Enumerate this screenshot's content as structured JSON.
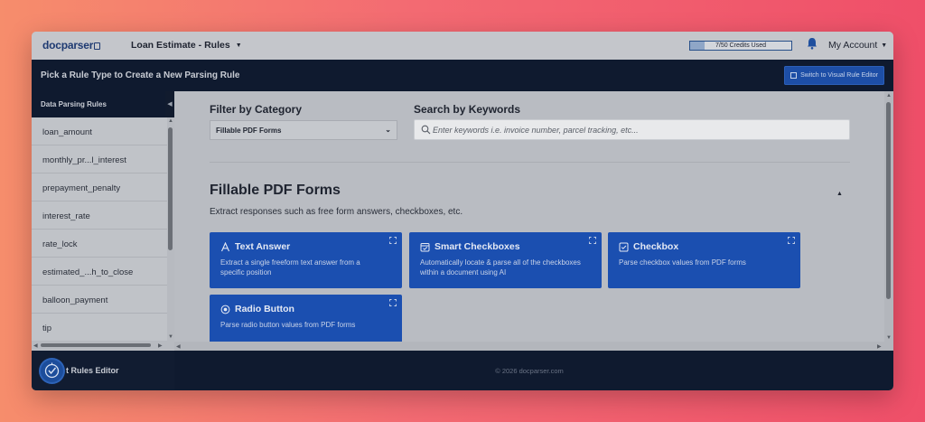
{
  "app": {
    "logo_text": "docparser",
    "document_title": "Loan Estimate - Rules",
    "credits": "7/50 Credits Used",
    "credits_fraction": 0.14,
    "account_label": "My Account"
  },
  "header": {
    "instruction": "Pick a Rule Type to Create a New Parsing Rule",
    "visual_editor_button": "Switch to Visual Rule Editor"
  },
  "sidebar": {
    "title": "Data Parsing Rules",
    "items": [
      {
        "label": "loan_amount"
      },
      {
        "label": "monthly_pr...l_interest"
      },
      {
        "label": "prepayment_penalty"
      },
      {
        "label": "interest_rate"
      },
      {
        "label": "rate_lock"
      },
      {
        "label": "estimated_...h_to_close"
      },
      {
        "label": "balloon_payment"
      },
      {
        "label": "tip"
      }
    ]
  },
  "filter": {
    "label": "Filter by Category",
    "selected": "Fillable PDF Forms"
  },
  "search": {
    "label": "Search by Keywords",
    "placeholder": "Enter keywords i.e. invoice number, parcel tracking, etc..."
  },
  "section": {
    "title": "Fillable PDF Forms",
    "description": "Extract responses such as free form answers, checkboxes, etc."
  },
  "cards": [
    {
      "title": "Text Answer",
      "description": "Extract a single freeform text answer from a specific position",
      "icon": "text-icon"
    },
    {
      "title": "Smart Checkboxes",
      "description": "Automatically locate & parse all of the checkboxes within a document using AI",
      "icon": "smart-checkbox-icon"
    },
    {
      "title": "Checkbox",
      "description": "Parse checkbox values from PDF forms",
      "icon": "checkbox-icon"
    },
    {
      "title": "Radio Button",
      "description": "Parse radio button values from PDF forms",
      "icon": "radio-icon"
    }
  ],
  "footer": {
    "rules_editor_label": "t Rules Editor",
    "copyright": "© 2026 docparser.com"
  },
  "colors": {
    "card_blue": "#1b4fb0",
    "dark_navy": "#0f1a2f",
    "visual_button": "#1d4ea6"
  }
}
